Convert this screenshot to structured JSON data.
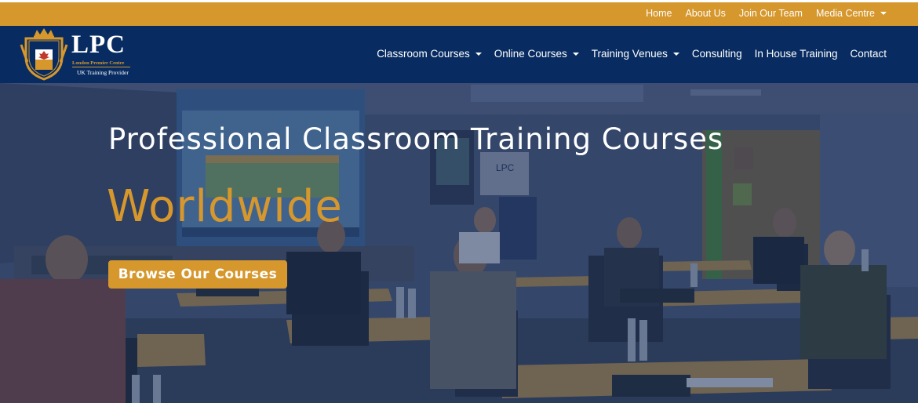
{
  "topbar": {
    "links": [
      "Home",
      "About Us",
      "Join Our Team"
    ],
    "media_centre": "Media Centre"
  },
  "logo": {
    "wordmark": "LPC",
    "subtitle": "London Premier Centre",
    "tagline": "UK Training Provider"
  },
  "nav": {
    "classroom": "Classroom Courses",
    "online": "Online Courses",
    "venues": "Training Venues",
    "consulting": "Consulting",
    "in_house": "In House Training",
    "contact": "Contact"
  },
  "hero": {
    "title": "Professional Classroom Training Courses",
    "subtitle": "Worldwide",
    "button": "Browse Our Courses",
    "slide_logo": "LPC"
  },
  "colors": {
    "gold": "#d6972d",
    "navy": "#082c61",
    "overlay": "#1b2f55"
  }
}
